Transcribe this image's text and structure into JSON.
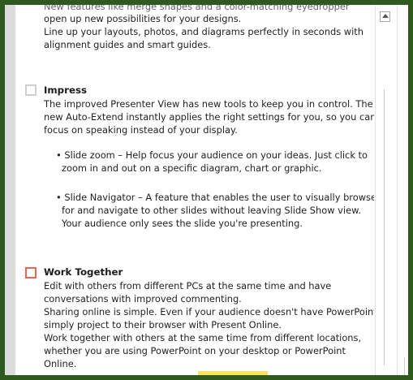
{
  "top": {
    "ghost_line": "New features like merge shapes and a color-matching eyedropper",
    "line1": "open up new possibilities for your designs.",
    "line2": "Line up your layouts, photos, and diagrams perfectly in seconds with",
    "line3": "alignment guides and smart guides."
  },
  "impress": {
    "heading": "Impress",
    "p1": "The improved Presenter View has new tools to keep you in control. The",
    "p2": "new Auto-Extend instantly applies the right settings for you, so you can",
    "p3": "focus on speaking instead of your display.",
    "b1_l1": "• Slide zoom – Help focus your audience on your ideas.  Just click to",
    "b1_l2": "zoom in and out on a specific diagram, chart or graphic.",
    "b2_l1": "• Slide Navigator – A feature that enables the user to visually browse",
    "b2_l2": "for and navigate to other slides without leaving Slide Show view.",
    "b2_l3": "Your audience only sees the slide you're presenting."
  },
  "work_together": {
    "heading": "Work Together",
    "l1": "Edit with others from different PCs at the same time and have",
    "l2": "conversations with improved commenting.",
    "l3": "Sharing online is simple. Even if your audience doesn't have PowerPoint,",
    "l4": "simply project to their browser with Present Online.",
    "l5": "Work together with others at the same time from different locations,",
    "l6": "whether you are using PowerPoint on your desktop or PowerPoint",
    "l7": "Online."
  },
  "icons": {
    "scroll_up": "scroll-up-arrow-icon",
    "checkbox": "checkbox-icon"
  },
  "colors": {
    "frame": "#2f5a1f",
    "checkbox_selected": "#e06a55",
    "checkbox_normal": "#cfcfcf",
    "highlight": "#ffe25a"
  }
}
